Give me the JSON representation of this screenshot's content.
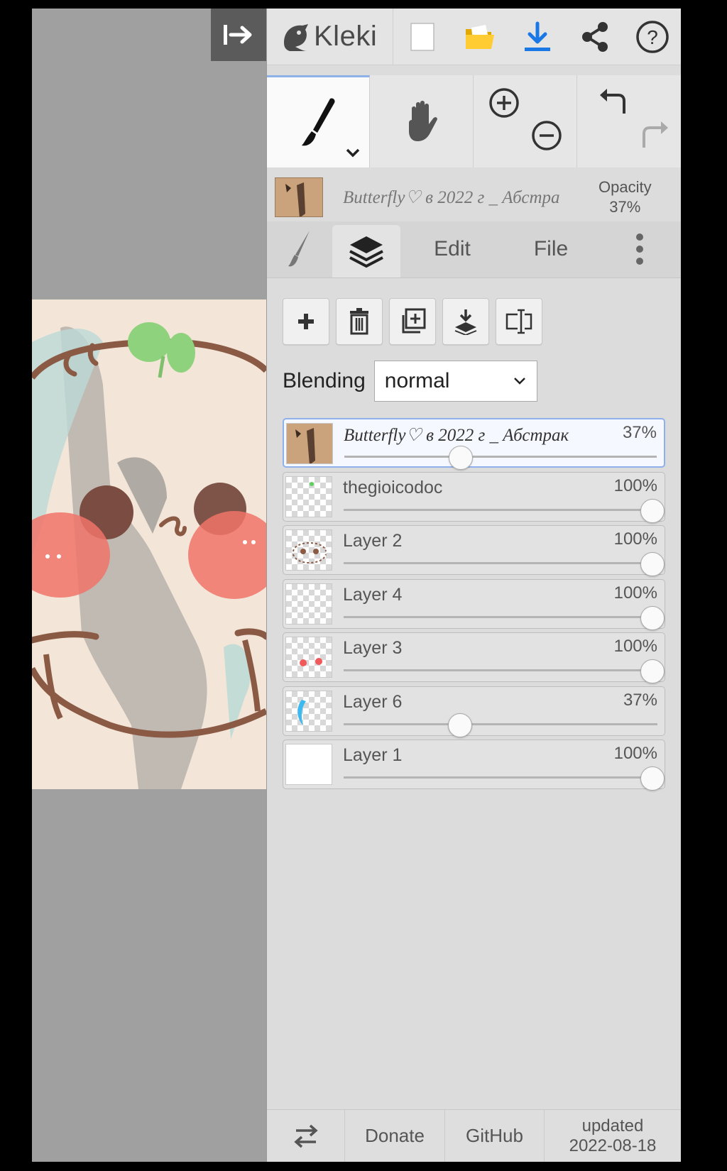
{
  "app": {
    "name": "Kleki"
  },
  "topbar": {
    "buttons": [
      "new-image",
      "open",
      "download",
      "share",
      "help"
    ],
    "download_color": "#1a78e6"
  },
  "tools": {
    "brush": "brush-icon",
    "hand": "hand-icon",
    "zoom_in": "zoom-in-icon",
    "zoom_out": "zoom-out-icon",
    "undo": "undo-icon",
    "redo": "redo-icon"
  },
  "document": {
    "title": "Butterfly♡ в 2022 г _ Абстра",
    "opacity_label": "Opacity",
    "opacity_value": "37%"
  },
  "tabs": [
    {
      "id": "brush",
      "icon": "brush-icon"
    },
    {
      "id": "layers",
      "icon": "layers-icon",
      "active": true
    },
    {
      "id": "edit",
      "label": "Edit"
    },
    {
      "id": "file",
      "label": "File"
    },
    {
      "id": "more",
      "icon": "more-vertical-icon"
    }
  ],
  "layer_actions": [
    "add-layer",
    "delete-layer",
    "duplicate-layer",
    "merge-down",
    "rename-layer"
  ],
  "blending": {
    "label": "Blending",
    "value": "normal"
  },
  "layers": [
    {
      "name": "Butterfly♡ в 2022 г _ Абстрак",
      "opacity": "37%",
      "fraction": 0.37,
      "selected": true,
      "thumb": "photo"
    },
    {
      "name": "thegioicodoc",
      "opacity": "100%",
      "fraction": 1.0,
      "thumb": "transparent"
    },
    {
      "name": "Layer 2",
      "opacity": "100%",
      "fraction": 1.0,
      "thumb": "transparent"
    },
    {
      "name": "Layer 4",
      "opacity": "100%",
      "fraction": 1.0,
      "thumb": "transparent"
    },
    {
      "name": "Layer 3",
      "opacity": "100%",
      "fraction": 1.0,
      "thumb": "transparent"
    },
    {
      "name": "Layer 6",
      "opacity": "37%",
      "fraction": 0.37,
      "thumb": "transparent"
    },
    {
      "name": "Layer 1",
      "opacity": "100%",
      "fraction": 1.0,
      "thumb": "white"
    }
  ],
  "bottombar": {
    "swap_icon": "swap-icon",
    "donate": "Donate",
    "github": "GitHub",
    "updated_label": "updated",
    "updated_date": "2022-08-18"
  }
}
